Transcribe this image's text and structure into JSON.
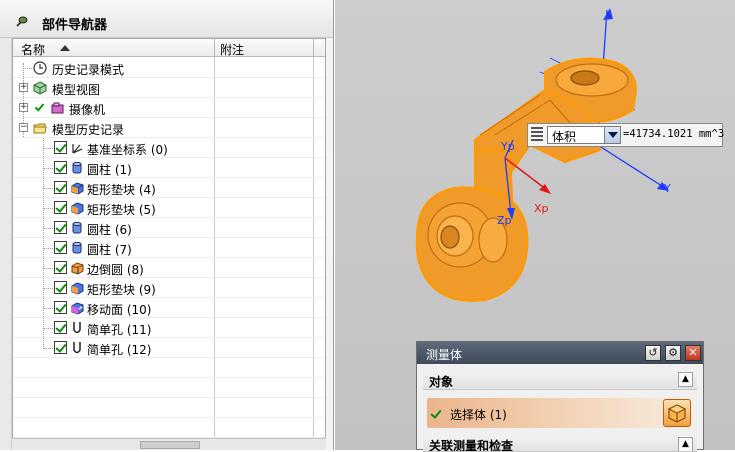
{
  "navigator": {
    "title": "部件导航器",
    "columns": {
      "name": "名称",
      "note": "附注"
    },
    "items": [
      {
        "label": "历史记录模式",
        "icon": "clock-icon"
      },
      {
        "label": "模型视图",
        "icon": "model-views-icon"
      },
      {
        "label": "摄像机",
        "icon": "camera-icon"
      },
      {
        "label": "模型历史记录",
        "icon": "folder-icon"
      },
      {
        "label": "基准坐标系 (0)",
        "icon": "datum-csys-icon"
      },
      {
        "label": "圆柱 (1)",
        "icon": "cylinder-icon"
      },
      {
        "label": "矩形垫块 (4)",
        "icon": "pad-icon"
      },
      {
        "label": "矩形垫块 (5)",
        "icon": "pad-icon"
      },
      {
        "label": "圆柱 (6)",
        "icon": "cylinder-icon"
      },
      {
        "label": "圆柱 (7)",
        "icon": "cylinder-icon"
      },
      {
        "label": "边倒圆 (8)",
        "icon": "edge-blend-icon"
      },
      {
        "label": "矩形垫块 (9)",
        "icon": "pad-icon"
      },
      {
        "label": "移动面 (10)",
        "icon": "move-face-icon"
      },
      {
        "label": "简单孔 (11)",
        "icon": "simple-hole-icon"
      },
      {
        "label": "简单孔 (12)",
        "icon": "simple-hole-icon"
      }
    ]
  },
  "viewport": {
    "axes": {
      "y": "Y",
      "zp": "Zp",
      "yp": "Yp",
      "xp": "Xp"
    },
    "colors": {
      "part": "#f09a2a",
      "selection": "#ff9900",
      "axis_blue": "#1e3cff",
      "axis_red": "#e01818"
    }
  },
  "measure_popup": {
    "selected_option": "体积",
    "value": "=41734.1021 mm^3"
  },
  "dialog": {
    "title": "测量体",
    "section_object": "对象",
    "select_body": "选择体 (1)",
    "section_associated": "关联测量和检查"
  }
}
